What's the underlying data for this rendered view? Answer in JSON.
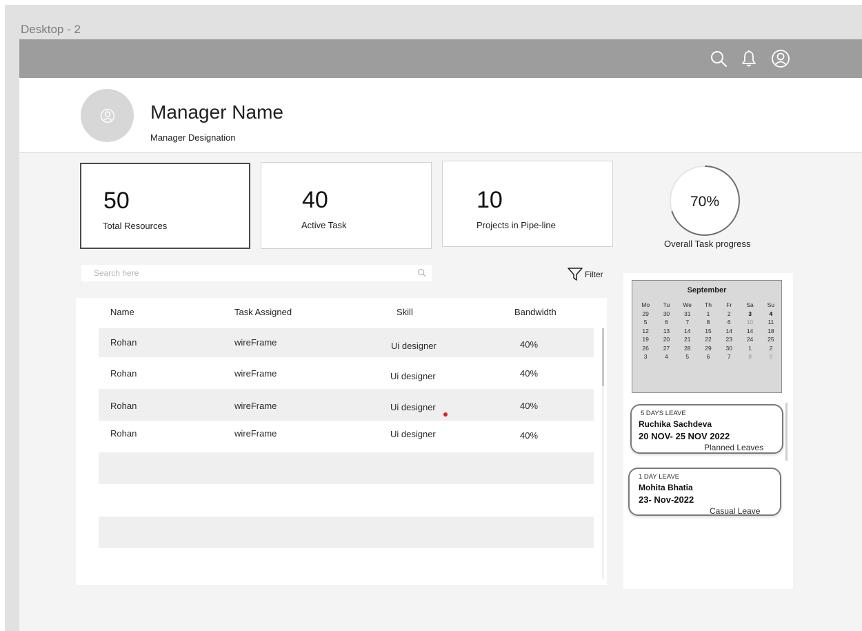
{
  "frame_label": "Desktop - 2",
  "topbar": {
    "icons": [
      "search-icon",
      "bell-icon",
      "user-icon"
    ]
  },
  "header": {
    "manager_name": "Manager Name",
    "manager_designation": "Manager Designation"
  },
  "stats": [
    {
      "value": "50",
      "label": "Total Resources"
    },
    {
      "value": "40",
      "label": "Active Task"
    },
    {
      "value": "10",
      "label": "Projects in Pipe-line"
    }
  ],
  "progress": {
    "value": 70,
    "text": "70%",
    "label": "Overall Task progress"
  },
  "search": {
    "placeholder": "Search here"
  },
  "filter": {
    "label": "Filter"
  },
  "table": {
    "headers": {
      "name": "Name",
      "task": "Task Assigned",
      "skill": "Skill",
      "bandwidth": "Bandwidth"
    },
    "rows": [
      {
        "name": "Rohan",
        "task": "wireFrame",
        "skill": "Ui designer",
        "bandwidth": "40%"
      },
      {
        "name": "Rohan",
        "task": "wireFrame",
        "skill": "Ui designer",
        "bandwidth": "40%"
      },
      {
        "name": "Rohan",
        "task": "wireFrame",
        "skill": "Ui designer",
        "bandwidth": "40%"
      },
      {
        "name": "Rohan",
        "task": "wireFrame",
        "skill": "Ui designer",
        "bandwidth": "40%"
      }
    ]
  },
  "calendar": {
    "month": "September",
    "weekdays": [
      "Mo",
      "Tu",
      "We",
      "Th",
      "Fr",
      "Sa",
      "Su"
    ],
    "weeks": [
      [
        "29",
        "30",
        "31",
        "1",
        "2",
        "3",
        "4"
      ],
      [
        "5",
        "6",
        "7",
        "8",
        "6",
        "10",
        "11"
      ],
      [
        "12",
        "13",
        "14",
        "15",
        "14",
        "14",
        "18"
      ],
      [
        "19",
        "20",
        "21",
        "22",
        "23",
        "24",
        "25"
      ],
      [
        "26",
        "27",
        "28",
        "29",
        "30",
        "1",
        "2"
      ],
      [
        "3",
        "4",
        "5",
        "6",
        "7",
        "8",
        "9"
      ]
    ]
  },
  "leaves": [
    {
      "type": "5 DAYS LEAVE",
      "name": "Ruchika Sachdeva",
      "dates": "20 NOV- 25 NOV 2022",
      "category": "Planned Leaves"
    },
    {
      "type": "1 DAY LEAVE",
      "name": "Mohita Bhatia",
      "dates": "23- Nov-2022",
      "category": "Casual Leave"
    }
  ]
}
